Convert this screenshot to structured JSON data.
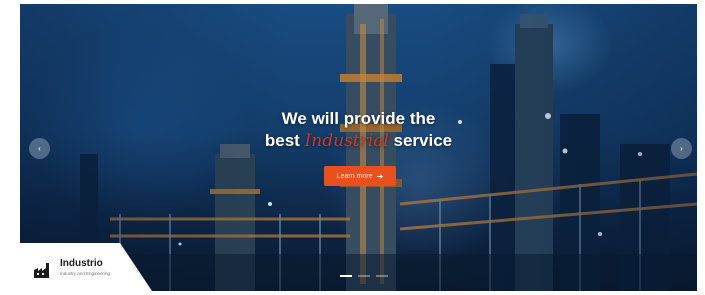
{
  "hero": {
    "headline_line1": "We will provide the",
    "headline_pre": "best",
    "headline_accent": "Industrial",
    "headline_post": "service",
    "cta_label": "Learn more",
    "cta_icon": "arrow-right-icon",
    "accent_color": "#d8341b",
    "cta_color": "#e8501f"
  },
  "carousel": {
    "prev_icon": "chevron-left-icon",
    "next_icon": "chevron-right-icon",
    "slide_count": 3,
    "active_index": 0
  },
  "brand": {
    "name": "Industrio",
    "tagline": "Industry and Engineering",
    "logo_icon": "factory-icon"
  }
}
